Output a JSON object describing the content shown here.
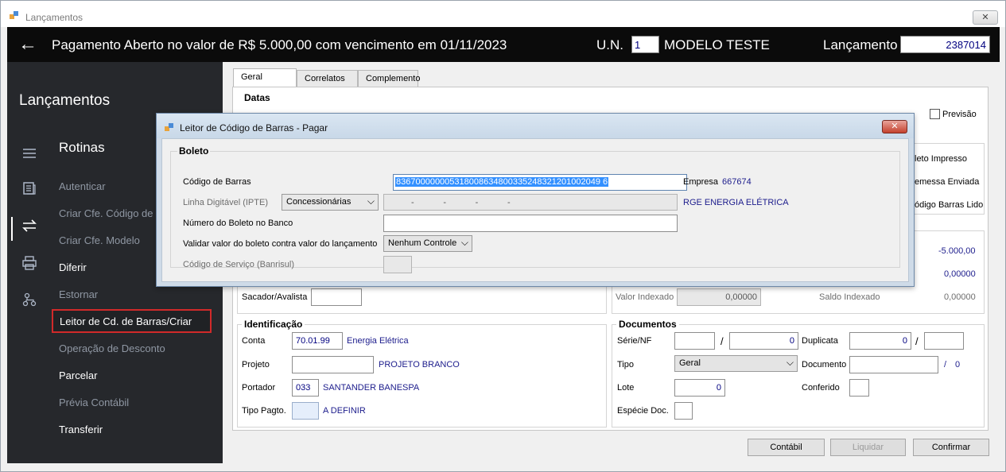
{
  "window": {
    "title": "Lançamentos",
    "close": "✕"
  },
  "header": {
    "back_icon": "←",
    "title": "Pagamento Aberto no valor de R$ 5.000,00 com vencimento em 01/11/2023",
    "un_label": "U.N.",
    "un_value": "1",
    "modelo": "MODELO TESTE",
    "lancamento_label": "Lançamento",
    "lancamento_value": "2387014"
  },
  "sidebar": {
    "title": "Lançamentos",
    "section": "Rotinas",
    "items": [
      {
        "label": "Autenticar"
      },
      {
        "label": "Criar Cfe. Código de"
      },
      {
        "label": "Criar Cfe. Modelo"
      },
      {
        "label": "Diferir"
      },
      {
        "label": "Estornar"
      },
      {
        "label": "Leitor de Cd. de Barras/Criar"
      },
      {
        "label": "Operação de Desconto"
      },
      {
        "label": "Parcelar"
      },
      {
        "label": "Prévia Contábil"
      },
      {
        "label": "Transferir"
      }
    ]
  },
  "tabs": [
    "Geral",
    "Correlatos",
    "Complemento"
  ],
  "datas": {
    "label": "Datas",
    "previsao": "Previsão"
  },
  "right_checks": [
    "leto Impresso",
    "emessa Enviada",
    "ódigo Barras Lido"
  ],
  "valores": {
    "value1": "-5.000,00",
    "value2": "0,00000",
    "sacador_label": "Sacador/Avalista",
    "valor_indexado_label": "Valor Indexado",
    "valor_indexado_value": "0,00000",
    "saldo_indexado_label": "Saldo Indexado",
    "saldo_indexado_value": "0,00000"
  },
  "identificacao": {
    "label": "Identificação",
    "conta_label": "Conta",
    "conta_value": "70.01.99",
    "conta_desc": "Energia Elétrica",
    "projeto_label": "Projeto",
    "projeto_desc": "PROJETO BRANCO",
    "portador_label": "Portador",
    "portador_value": "033",
    "portador_desc": "SANTANDER BANESPA",
    "tipo_pagto_label": "Tipo Pagto.",
    "tipo_pagto_desc": "A DEFINIR"
  },
  "documentos": {
    "label": "Documentos",
    "serie_label": "Série/NF",
    "serie_num": "0",
    "duplicata_label": "Duplicata",
    "duplicata_value": "0",
    "tipo_label": "Tipo",
    "tipo_value": "Geral",
    "documento_label": "Documento",
    "documento_suffix": "0",
    "lote_label": "Lote",
    "lote_value": "0",
    "conferido_label": "Conferido",
    "especie_label": "Espécie Doc."
  },
  "buttons": {
    "contabil": "Contábil",
    "liquidar": "Liquidar",
    "confirmar": "Confirmar"
  },
  "dialog": {
    "title": "Leitor de Código de Barras - Pagar",
    "close": "✕",
    "group_label": "Boleto",
    "codigo_barras_label": "Código de Barras",
    "codigo_barras_value": "836700000005318008634800335248321201002049 6",
    "empresa_label": "Empresa",
    "empresa_value": "667674",
    "linha_digitavel_label": "Linha Digitável (IPTE)",
    "linha_digitavel_select": "Concessionárias",
    "linha_digitavel_mask": "-            -            -            -",
    "empresa_nome": "RGE ENERGIA ELÉTRICA",
    "numero_boleto_label": "Número do Boleto no Banco",
    "validar_label": "Validar valor do boleto contra valor do lançamento",
    "validar_select": "Nenhum Controle",
    "codigo_servico_label": "Código de Serviço (Banrisul)"
  }
}
